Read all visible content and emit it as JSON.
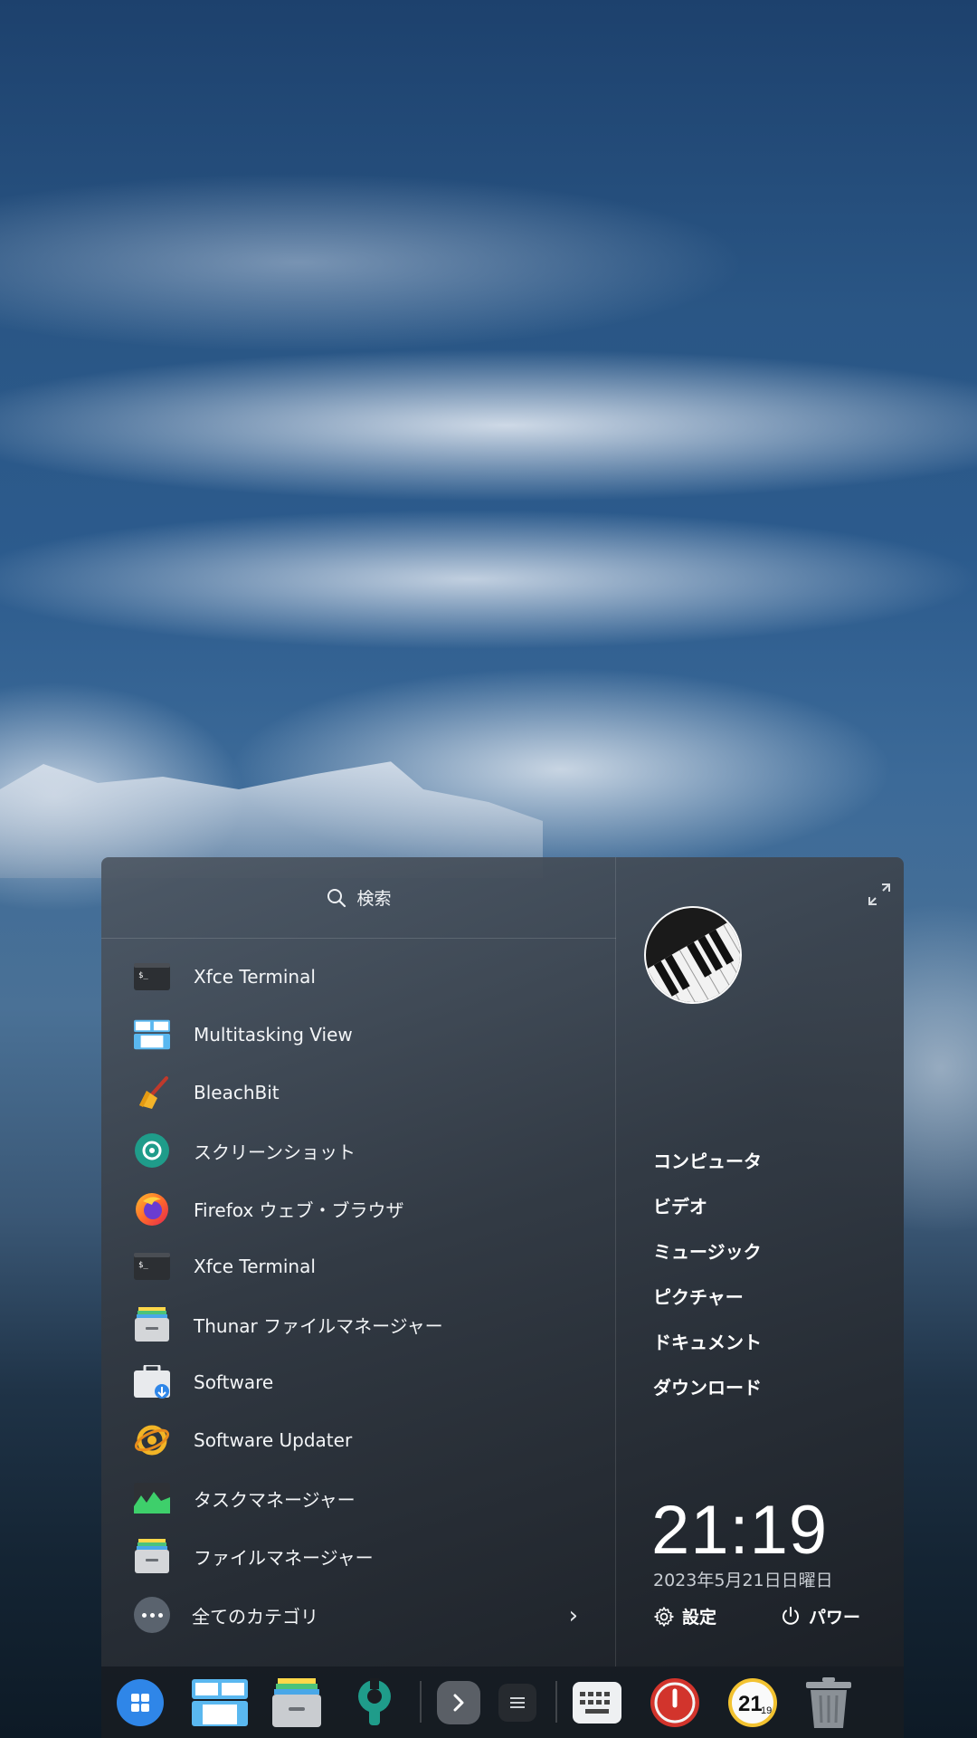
{
  "search": {
    "label": "検索"
  },
  "apps": [
    {
      "label": "Xfce Terminal",
      "icon": "terminal-icon"
    },
    {
      "label": "Multitasking View",
      "icon": "multitasking-icon"
    },
    {
      "label": "BleachBit",
      "icon": "broom-icon"
    },
    {
      "label": "スクリーンショット",
      "icon": "screenshot-icon"
    },
    {
      "label": "Firefox ウェブ・ブラウザ",
      "icon": "firefox-icon"
    },
    {
      "label": "Xfce Terminal",
      "icon": "terminal-icon"
    },
    {
      "label": "Thunar ファイルマネージャー",
      "icon": "file-cabinet-icon"
    },
    {
      "label": "Software",
      "icon": "software-store-icon"
    },
    {
      "label": "Software Updater",
      "icon": "updater-icon"
    },
    {
      "label": "タスクマネージャー",
      "icon": "task-manager-icon"
    },
    {
      "label": "ファイルマネージャー",
      "icon": "file-cabinet-icon"
    }
  ],
  "all_categories": {
    "label": "全てのカテゴリ"
  },
  "places": [
    "コンピュータ",
    "ビデオ",
    "ミュージック",
    "ピクチャー",
    "ドキュメント",
    "ダウンロード"
  ],
  "clock": {
    "time": "21:19",
    "date": "2023年5月21日日曜日"
  },
  "actions": {
    "settings": "設定",
    "power": "パワー"
  },
  "dock": {
    "items": [
      {
        "name": "launcher-icon"
      },
      {
        "name": "multitasking-icon"
      },
      {
        "name": "file-manager-icon"
      },
      {
        "name": "settings-wrench-icon"
      },
      {
        "name": "tray-expand-icon"
      },
      {
        "name": "tray-menu-icon"
      },
      {
        "name": "keyboard-icon"
      },
      {
        "name": "power-icon"
      },
      {
        "name": "clock-icon",
        "time_top": "21",
        "time_bottom": "19"
      },
      {
        "name": "trash-icon"
      }
    ]
  },
  "colors": {
    "accent": "#2f86e8",
    "power_red": "#d2342c",
    "task_green": "#3ecf6b"
  }
}
